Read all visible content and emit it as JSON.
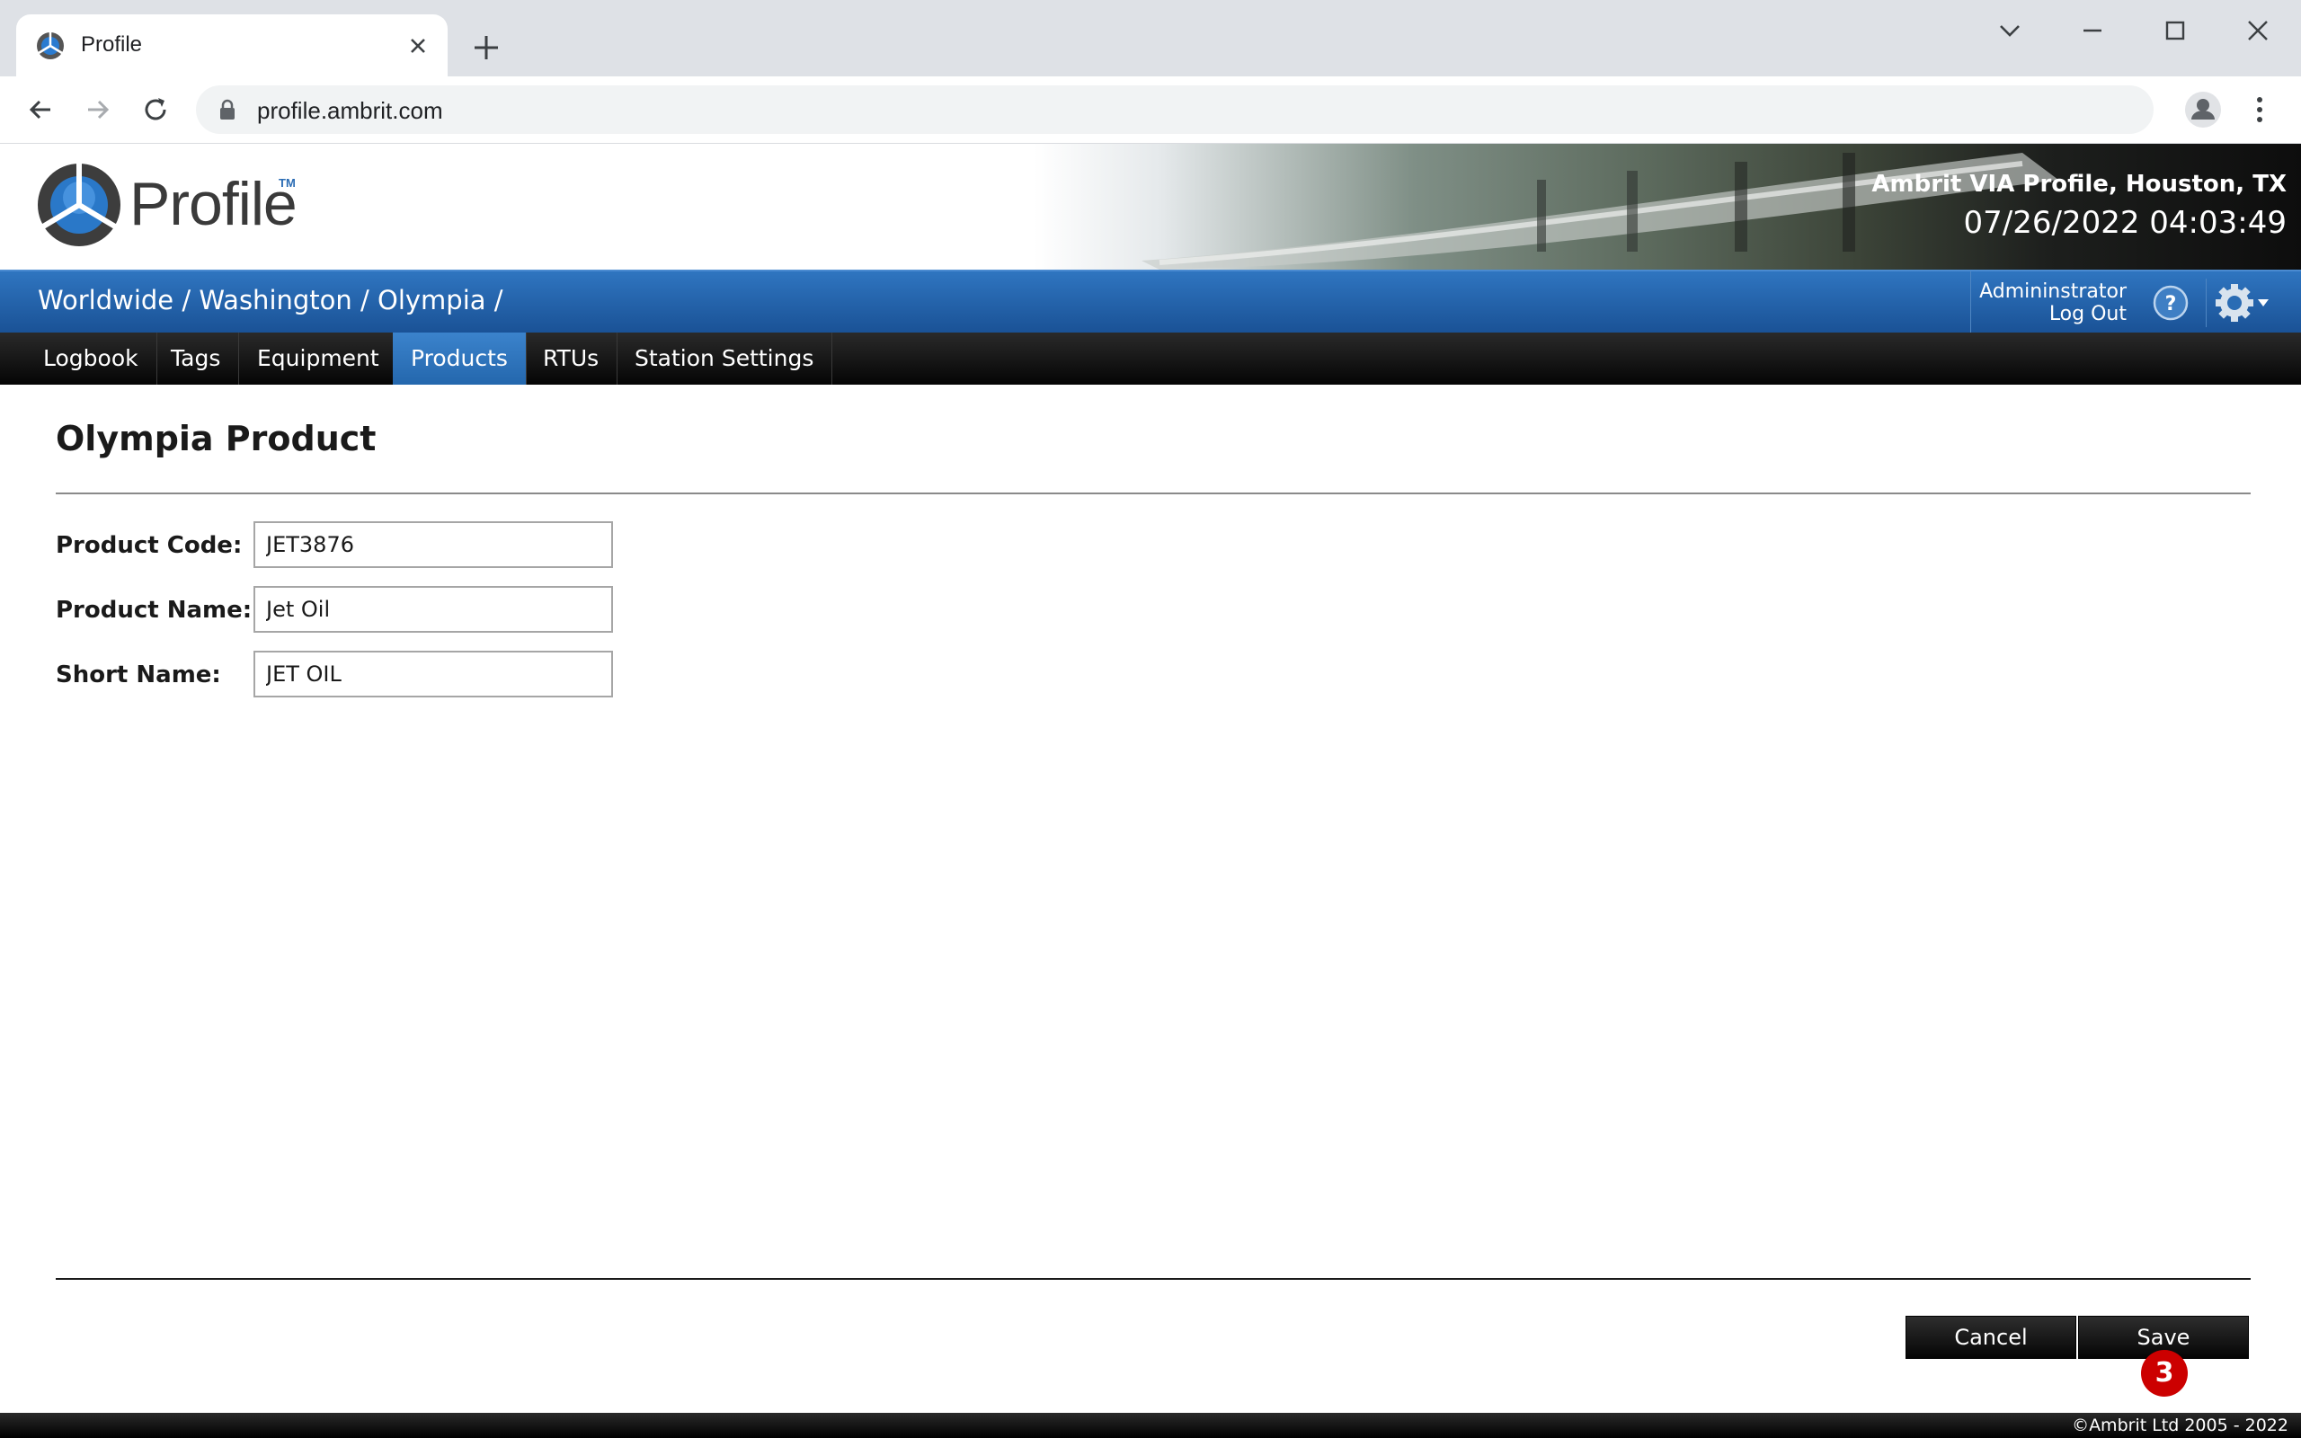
{
  "browser": {
    "tab_title": "Profile",
    "url": "profile.ambrit.com"
  },
  "header": {
    "logo_text": "Profile",
    "logo_tm": "TM",
    "site_name": "Ambrit VIA Profile, Houston, TX",
    "datetime": "07/26/2022 04:03:49"
  },
  "breadcrumb": {
    "items": [
      "Worldwide",
      "Washington",
      "Olympia"
    ],
    "separator": "/"
  },
  "user": {
    "name": "Admininstrator",
    "logout_label": "Log Out"
  },
  "nav": {
    "items": [
      {
        "label": "Logbook"
      },
      {
        "label": "Tags"
      },
      {
        "label": "Equipment"
      },
      {
        "label": "Products"
      },
      {
        "label": "RTUs"
      },
      {
        "label": "Station Settings"
      }
    ],
    "active": "Products"
  },
  "form": {
    "title": "Olympia Product",
    "fields": [
      {
        "label": "Product Code:",
        "value": "JET3876"
      },
      {
        "label": "Product Name:",
        "value": "Jet Oil"
      },
      {
        "label": "Short Name:",
        "value": "JET OIL"
      }
    ]
  },
  "actions": {
    "cancel_label": "Cancel",
    "save_label": "Save",
    "badge": "3"
  },
  "footer": {
    "copyright": "©Ambrit Ltd 2005 - 2022"
  },
  "colors": {
    "accent_blue": "#2467ad",
    "nav_black": "#050505",
    "badge_red": "#cc0000"
  }
}
